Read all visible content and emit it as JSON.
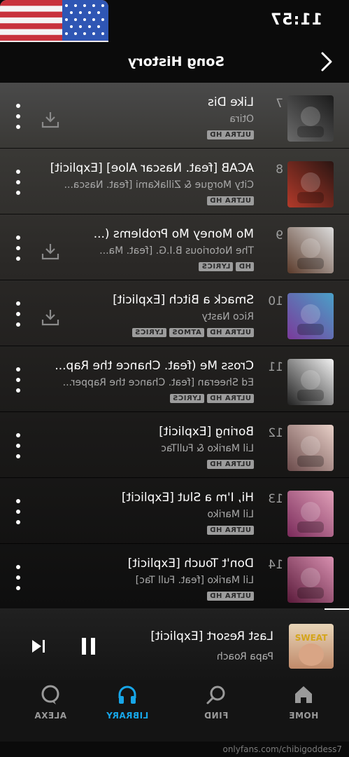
{
  "status_bar": {
    "time": "11:57"
  },
  "header": {
    "title": "Song History"
  },
  "tracks": [
    {
      "number": "7",
      "title": "Like Dis",
      "artist": "Otira",
      "badges": [
        "ULTRA HD"
      ],
      "download": true,
      "art_colors": [
        "#1a1a1a",
        "#6b6b6b"
      ]
    },
    {
      "number": "8",
      "title": "ACAB [feat. Nascar Aloe] [Explicit]",
      "artist": "City Morgue & ZillaKami [feat. Nasca...",
      "badges": [
        "ULTRA HD"
      ],
      "download": false,
      "art_colors": [
        "#2a1512",
        "#b33a2a"
      ]
    },
    {
      "number": "9",
      "title": "Mo Money Mo Problems (...",
      "artist": "The Notorious B.I.G. [feat. Ma...",
      "badges": [
        "HD",
        "LYRICS"
      ],
      "download": true,
      "art_colors": [
        "#dcdcdc",
        "#5a3a2a"
      ]
    },
    {
      "number": "10",
      "title": "Smack a Bitch [Explicit]",
      "artist": "Rico Nasty",
      "badges": [
        "ULTRA HD",
        "ATMOS",
        "LYRICS"
      ],
      "download": true,
      "art_colors": [
        "#4aa0c8",
        "#7a3a9a"
      ]
    },
    {
      "number": "11",
      "title": "Cross Me (feat. Chance the Rap...",
      "artist": "Ed Sheeran [feat. Chance the Rapper...",
      "badges": [
        "ULTRA HD",
        "LYRICS"
      ],
      "download": false,
      "art_colors": [
        "#f2f2f2",
        "#202020"
      ]
    },
    {
      "number": "12",
      "title": "Boring [Explicit]",
      "artist": "Lil Mariko & FullTac",
      "badges": [
        "ULTRA HD"
      ],
      "download": false,
      "art_colors": [
        "#e8d0c8",
        "#6a4a4a"
      ]
    },
    {
      "number": "13",
      "title": "Hi, I'm a Slut [Explicit]",
      "artist": "Lil Mariko",
      "badges": [
        "ULTRA HD"
      ],
      "download": false,
      "art_colors": [
        "#e0a0b8",
        "#7a2a5a"
      ]
    },
    {
      "number": "14",
      "title": "Don't Touch [Explicit]",
      "artist": "Lil Mariko [feat. Full Tac]",
      "badges": [
        "ULTRA HD"
      ],
      "download": false,
      "art_colors": [
        "#d890b0",
        "#5a1a3a"
      ]
    }
  ],
  "now_playing": {
    "title": "Last Resort [Explicit]",
    "artist": "Papa Roach",
    "progress": 0.07,
    "art_text": "SWEAT"
  },
  "nav": {
    "home": "HOME",
    "find": "FIND",
    "library": "LIBRARY",
    "alexa": "ALEXA",
    "active": "library",
    "active_color": "#17a6e8"
  },
  "watermark": "onlyfans.com/chibigoddess7",
  "icons": {
    "back": "chevron-left-icon",
    "more": "more-vertical-icon",
    "download": "download-icon",
    "pause": "pause-icon",
    "previous": "skip-previous-icon",
    "home": "home-icon",
    "find": "search-icon",
    "library": "headphones-icon",
    "alexa": "alexa-ring-icon"
  }
}
